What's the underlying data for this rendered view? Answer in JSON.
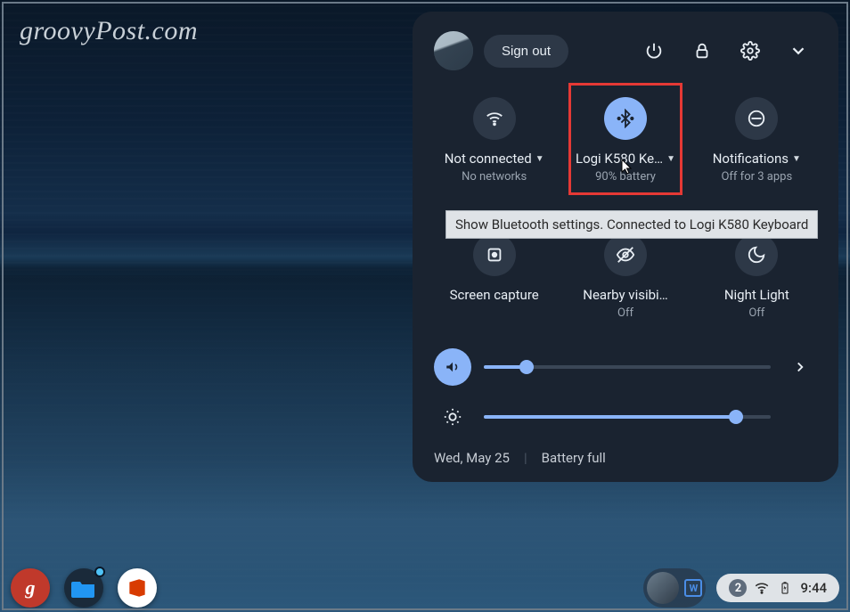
{
  "watermark": "groovyPost.com",
  "header": {
    "signout_label": "Sign out"
  },
  "tiles": [
    {
      "label": "Not connected",
      "sub": "No networks",
      "has_caret": true
    },
    {
      "label": "Logi K580 Ke…",
      "sub": "90% battery",
      "has_caret": true
    },
    {
      "label": "Notifications",
      "sub": "Off for 3 apps",
      "has_caret": true
    },
    {
      "label": "Screen capture",
      "sub": ""
    },
    {
      "label": "Nearby visibi…",
      "sub": "Off"
    },
    {
      "label": "Night Light",
      "sub": "Off"
    }
  ],
  "tooltip": "Show Bluetooth settings. Connected to Logi K580 Keyboard",
  "sliders": {
    "volume_percent": 15,
    "brightness_percent": 88
  },
  "footer": {
    "date": "Wed, May 25",
    "battery": "Battery full"
  },
  "tray": {
    "badge_letter": "W",
    "notif_count": "2",
    "clock": "9:44"
  }
}
